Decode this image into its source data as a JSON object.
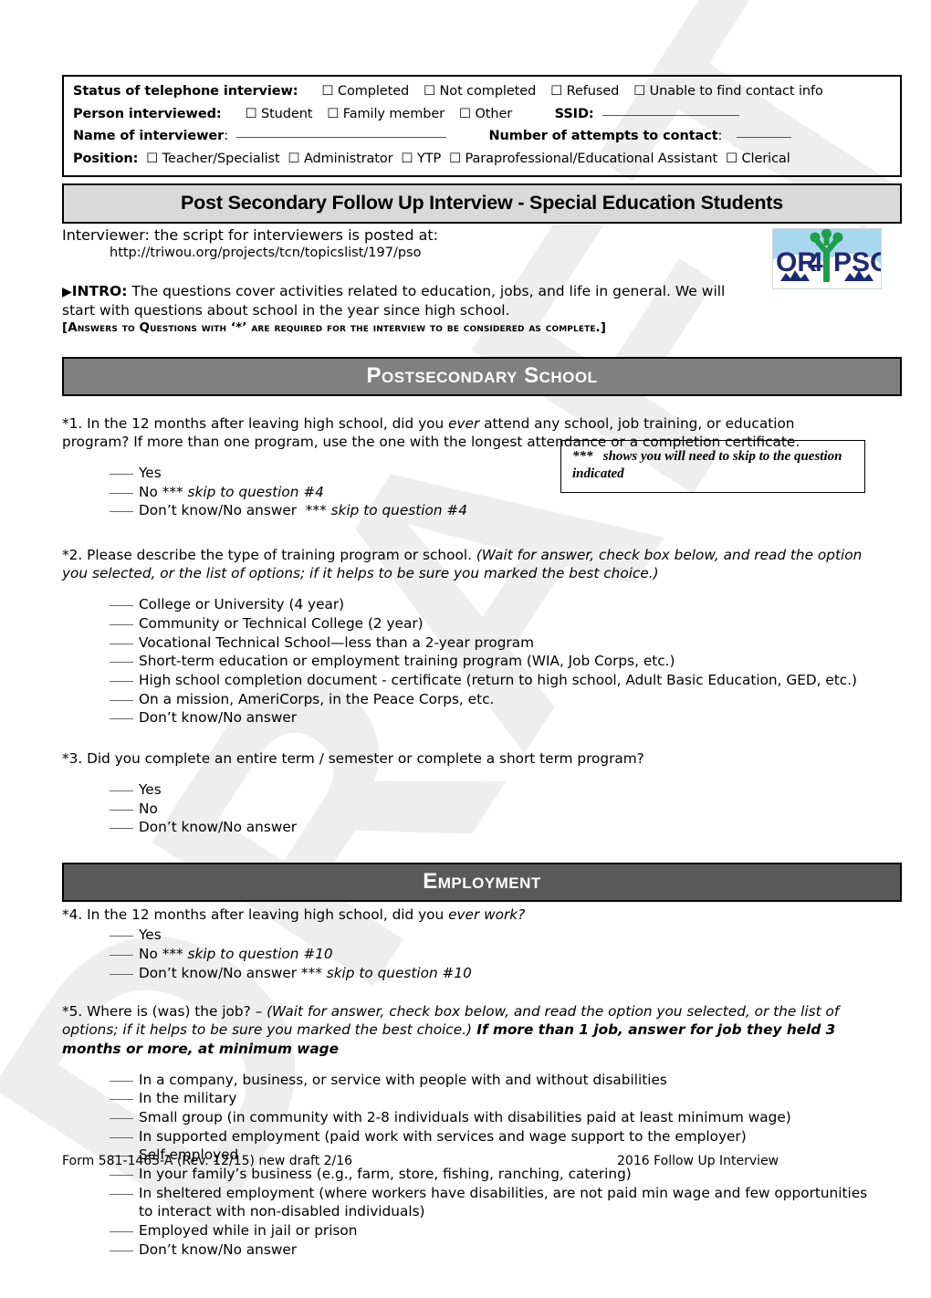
{
  "status_box": {
    "row_status": {
      "label": "Status of telephone interview:",
      "options": [
        "Completed",
        "Not completed",
        "Refused",
        "Unable to find contact info"
      ]
    },
    "row_person": {
      "label": "Person interviewed:",
      "options": [
        "Student",
        "Family member",
        "Other"
      ],
      "ssid_label": "SSID:",
      "ssid_value": ""
    },
    "row_name": {
      "label": "Name of interviewer",
      "label_suffix": ":",
      "value": "",
      "attempts_label": "Number of attempts to contact",
      "attempts_suffix": ":",
      "attempts_value": ""
    },
    "row_position": {
      "label": "Position:",
      "options": [
        "Teacher/Specialist",
        "Administrator",
        "YTP",
        "Paraprofessional/Educational Assistant",
        "Clerical"
      ]
    },
    "checkbox_glyph": "☐"
  },
  "title": "Post Secondary Follow Up Interview  - Special Education Students",
  "intro": {
    "interviewer_line": "Interviewer: the script for interviewers is posted at:",
    "url": "http://triwou.org/projects/tcn/topicslist/197/pso",
    "intro_arrow": "▶",
    "intro_label": "INTRO:",
    "intro_body": "The questions cover activities related to education, jobs, and life in general.  We will start with questions about school in the year since high school.",
    "required_note": "[Answers to Questions with ‘*’ are required for the interview to be considered as complete.]",
    "logo_text_left": "OR",
    "logo_text_num": "4",
    "logo_text_right": "PSO"
  },
  "watermark": {
    "text": "DRAFT"
  },
  "sections": {
    "postsecondary": {
      "heading": "Postsecondary School"
    },
    "employment": {
      "heading": "Employment"
    }
  },
  "skip_note": {
    "stars": "***",
    "text": "shows you will need to skip to the question indicated"
  },
  "questions": {
    "q1": {
      "text_pre": "*1. In the 12 months after leaving high school, did you ",
      "text_em": "ever",
      "text_post": " attend any school, job training, or education program?  If more than one program, use the one with the longest attendance or a completion certificate.",
      "options": [
        {
          "label": "Yes",
          "skip": ""
        },
        {
          "label": "No",
          "skip": "*** skip to question #4"
        },
        {
          "label": "Don’t know/No answer",
          "skip": "*** skip to question #4"
        }
      ]
    },
    "q2": {
      "text_pre": "*2.  Please describe the type of training program or school.  ",
      "text_em": "(Wait for answer, check box below, and read the option you selected, or the list of options; if it helps to be sure you marked the best choice.)",
      "options": [
        "College or University (4 year)",
        "Community or Technical College (2 year)",
        "Vocational Technical School—less than a 2-year program",
        "Short-term education or employment training program (WIA, Job Corps, etc.)",
        "High school completion document - certificate (return to high school, Adult Basic Education, GED, etc.)",
        "On a mission, AmeriCorps, in the Peace Corps, etc.",
        "Don’t know/No answer"
      ]
    },
    "q3": {
      "text": "*3. Did you complete an entire term / semester or complete a short term program?",
      "options": [
        "Yes",
        "No",
        "Don’t know/No answer"
      ]
    },
    "q4": {
      "text_pre": "*4. In the 12 months after leaving high school, did you ",
      "text_em": "ever work?",
      "options": [
        {
          "label": "Yes",
          "skip": ""
        },
        {
          "label": "No",
          "skip": "*** skip to question #10"
        },
        {
          "label": "Don’t know/No answer",
          "skip": "*** skip to question #10"
        }
      ]
    },
    "q5": {
      "text_pre": "*5. Where is (was) the job? –  ",
      "text_em": "(Wait for answer, check box below, and read the option you selected, or the list of options; if it helps to be sure you marked the best choice.)",
      "text_bold": "  If more than 1 job, answer for job they held 3 months or more, at minimum wage",
      "options": [
        "In a company, business, or service with people with and without disabilities",
        "In the military",
        "Small group (in community with 2-8 individuals with disabilities paid at least minimum wage)",
        "In supported employment (paid work with services and wage support to the employer)",
        "Self-employed",
        "In your family’s business (e.g., farm, store, fishing, ranching, catering)",
        "In sheltered employment (where workers have disabilities, are not paid min wage and few opportunities",
        "Employed while in jail or prison",
        "Don’t know/No answer"
      ],
      "option_7_continuation": "to interact with non-disabled individuals)"
    }
  },
  "footer": {
    "left": "Form 581-1465-A (Rev. 12/15)  new draft 2/16",
    "right": "2016 Follow Up Interview"
  },
  "colors": {
    "section_bar_light": "#808080",
    "section_bar_dark": "#595959",
    "title_bar_bg": "#d9d9d9",
    "watermark": "#eeeeee",
    "logo_green": "#1f9e4d",
    "logo_navy": "#1f2a6e",
    "logo_sky": "#a9d8ee"
  }
}
